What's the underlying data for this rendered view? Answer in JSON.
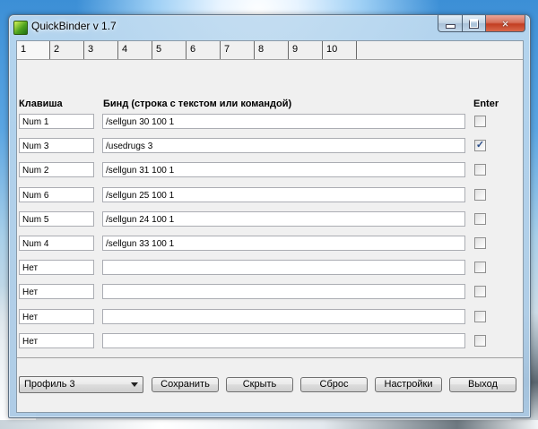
{
  "window": {
    "title": "QuickBinder v 1.7",
    "close_glyph": "×"
  },
  "tabs": [
    "1",
    "2",
    "3",
    "4",
    "5",
    "6",
    "7",
    "8",
    "9",
    "10"
  ],
  "active_tab": "1",
  "headers": {
    "key": "Клавиша",
    "bind": "Бинд (строка с текстом или командой)",
    "enter": "Enter"
  },
  "rows": [
    {
      "key": "Num 1",
      "bind": "/sellgun  30 100 1",
      "enter": false
    },
    {
      "key": "Num 3",
      "bind": "/usedrugs 3",
      "enter": true
    },
    {
      "key": "Num 2",
      "bind": "/sellgun  31 100 1",
      "enter": false
    },
    {
      "key": "Num 6",
      "bind": "/sellgun   25 100 1",
      "enter": false
    },
    {
      "key": "Num 5",
      "bind": "/sellgun   24 100 1",
      "enter": false
    },
    {
      "key": "Num 4",
      "bind": "/sellgun   33 100 1",
      "enter": false
    },
    {
      "key": "Нет",
      "bind": "",
      "enter": false
    },
    {
      "key": "Нет",
      "bind": "",
      "enter": false
    },
    {
      "key": "Нет",
      "bind": "",
      "enter": false
    },
    {
      "key": "Нет",
      "bind": "",
      "enter": false
    }
  ],
  "check_glyph": "✓",
  "profile": {
    "selected": "Профиль 3"
  },
  "buttons": {
    "save": "Сохранить",
    "hide": "Скрыть",
    "reset": "Сброс",
    "settings": "Настройки",
    "exit": "Выход"
  }
}
